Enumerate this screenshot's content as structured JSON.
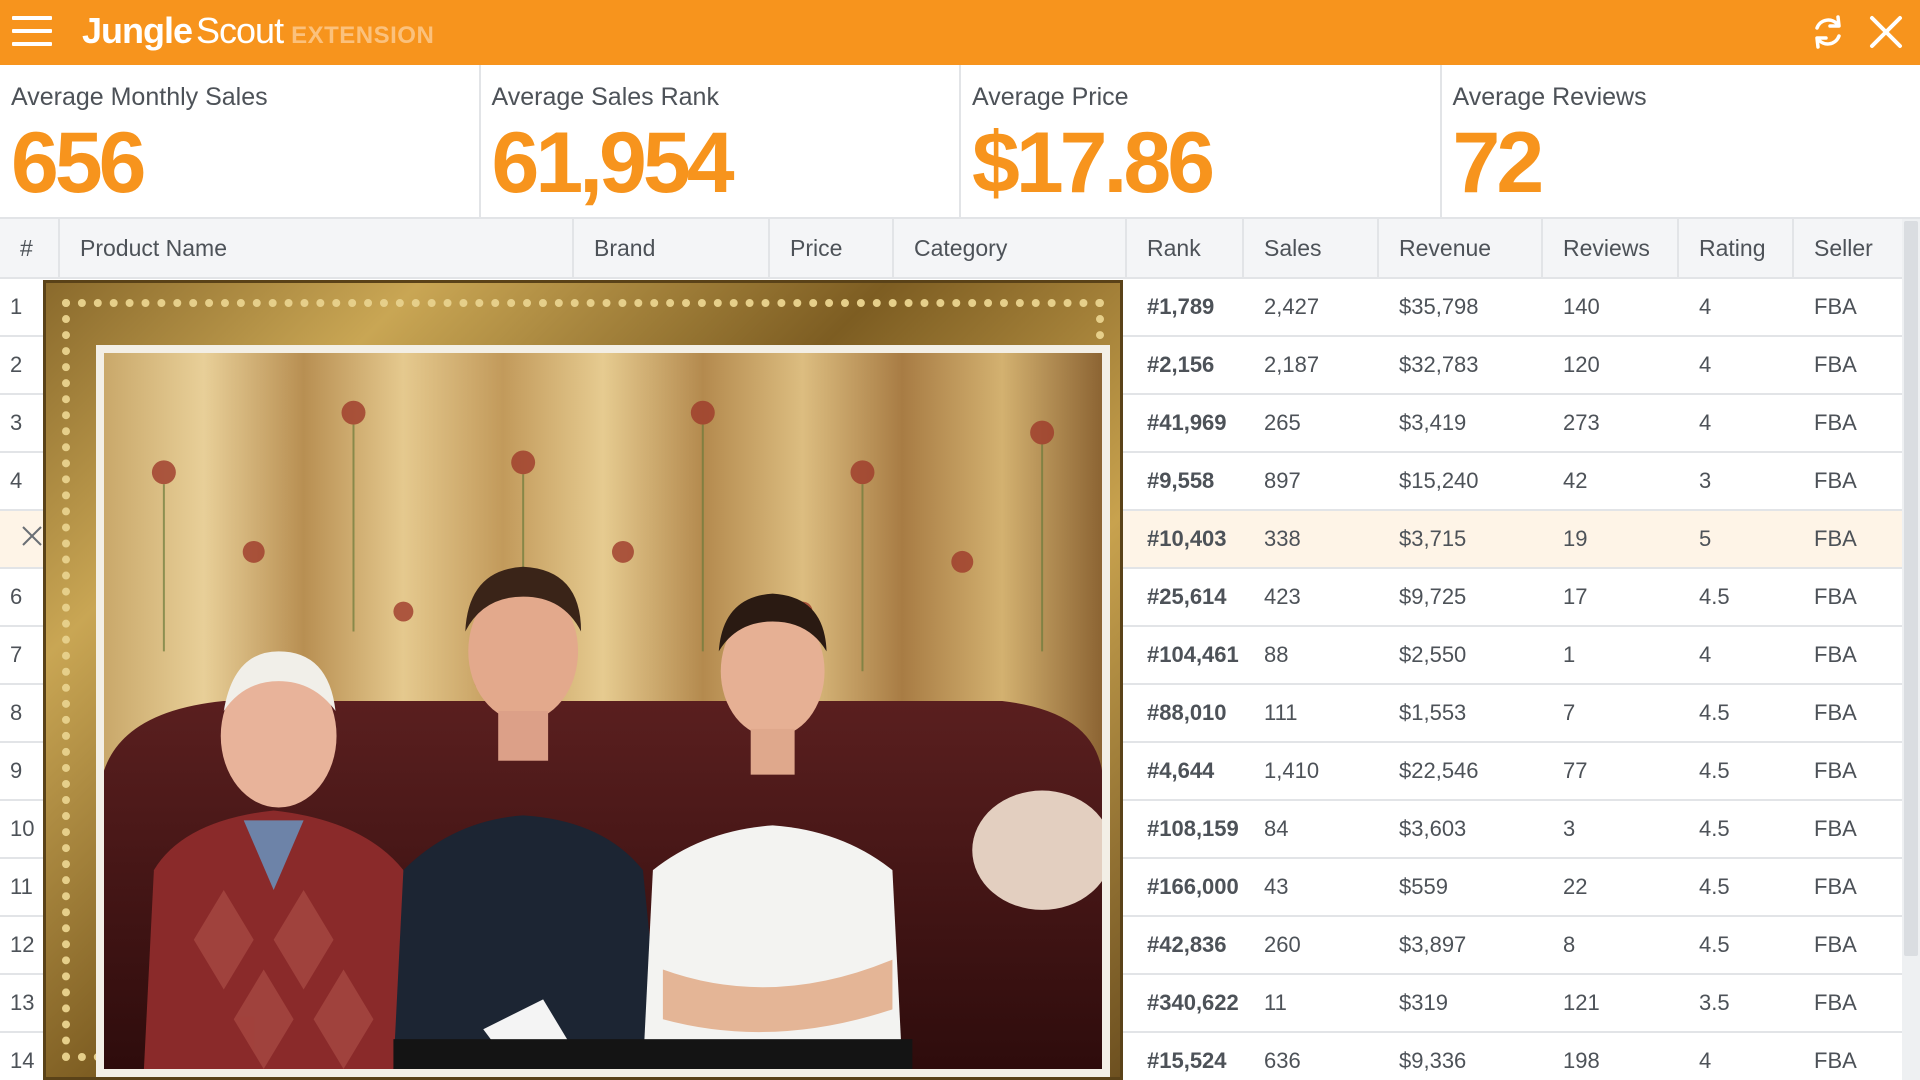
{
  "header": {
    "brand_jungle": "Jungle",
    "brand_scout": "Scout",
    "brand_extension": "EXTENSION",
    "icons": [
      "menu-icon",
      "refresh-icon",
      "close-icon"
    ]
  },
  "stats": [
    {
      "label": "Average Monthly Sales",
      "value": "656"
    },
    {
      "label": "Average Sales Rank",
      "value": "61,954"
    },
    {
      "label": "Average Price",
      "value": "$17.86"
    },
    {
      "label": "Average Reviews",
      "value": "72"
    }
  ],
  "table": {
    "columns": [
      "#",
      "Product Name",
      "Brand",
      "Price",
      "Category",
      "Rank",
      "Sales",
      "Revenue",
      "Reviews",
      "Rating",
      "Seller"
    ],
    "rows": [
      {
        "num": "1",
        "rank": "#1,789",
        "sales": "2,427",
        "revenue": "$35,798",
        "reviews": "140",
        "rating": "4",
        "seller": "FBA"
      },
      {
        "num": "2",
        "rank": "#2,156",
        "sales": "2,187",
        "revenue": "$32,783",
        "reviews": "120",
        "rating": "4",
        "seller": "FBA"
      },
      {
        "num": "3",
        "rank": "#41,969",
        "sales": "265",
        "revenue": "$3,419",
        "reviews": "273",
        "rating": "4",
        "seller": "FBA"
      },
      {
        "num": "4",
        "rank": "#9,558",
        "sales": "897",
        "revenue": "$15,240",
        "reviews": "42",
        "rating": "3",
        "seller": "FBA"
      },
      {
        "num": "",
        "rank": "#10,403",
        "sales": "338",
        "revenue": "$3,715",
        "reviews": "19",
        "rating": "5",
        "seller": "FBA",
        "highlight": true
      },
      {
        "num": "6",
        "rank": "#25,614",
        "sales": "423",
        "revenue": "$9,725",
        "reviews": "17",
        "rating": "4.5",
        "seller": "FBA"
      },
      {
        "num": "7",
        "rank": "#104,461",
        "sales": "88",
        "revenue": "$2,550",
        "reviews": "1",
        "rating": "4",
        "seller": "FBA"
      },
      {
        "num": "8",
        "rank": "#88,010",
        "sales": "111",
        "revenue": "$1,553",
        "reviews": "7",
        "rating": "4.5",
        "seller": "FBA"
      },
      {
        "num": "9",
        "rank": "#4,644",
        "sales": "1,410",
        "revenue": "$22,546",
        "reviews": "77",
        "rating": "4.5",
        "seller": "FBA"
      },
      {
        "num": "10",
        "rank": "#108,159",
        "sales": "84",
        "revenue": "$3,603",
        "reviews": "3",
        "rating": "4.5",
        "seller": "FBA"
      },
      {
        "num": "11",
        "rank": "#166,000",
        "sales": "43",
        "revenue": "$559",
        "reviews": "22",
        "rating": "4.5",
        "seller": "FBA"
      },
      {
        "num": "12",
        "rank": "#42,836",
        "sales": "260",
        "revenue": "$3,897",
        "reviews": "8",
        "rating": "4.5",
        "seller": "FBA"
      },
      {
        "num": "13",
        "rank": "#340,622",
        "sales": "11",
        "revenue": "$319",
        "reviews": "121",
        "rating": "3.5",
        "seller": "FBA"
      },
      {
        "num": "14",
        "rank": "#15,524",
        "sales": "636",
        "revenue": "$9,336",
        "reviews": "198",
        "rating": "4",
        "seller": "FBA"
      }
    ]
  },
  "overlay": {
    "image": "framed-photo"
  },
  "colors": {
    "accent": "#f7941d",
    "header_bg": "#f4f5f7",
    "border": "#e2e4e7",
    "highlight_row": "#fef4e7",
    "text": "#4d5258"
  }
}
